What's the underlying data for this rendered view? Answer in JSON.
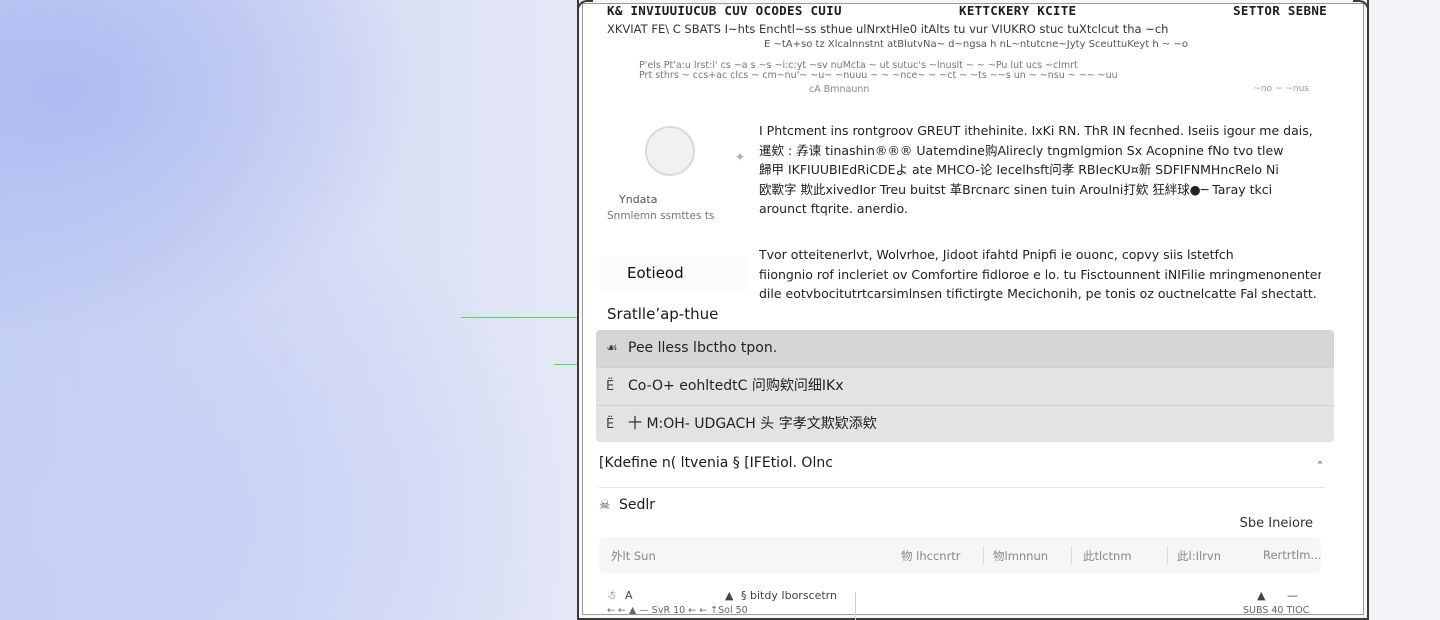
{
  "header": {
    "left_title": "K& INVIUUIUCUB CUV OCODES CUIU",
    "center_title": "KETTCKERY KCITE",
    "right_title": "SETTOR SEBNE",
    "subtitle": "XKVIAT FE\\ C SBATS I~hts Enchtl~ss sthue ulNrxtHle0 itAlts tu vur VIUKRO stuc tuXtclcut tha ~ch",
    "subtitle2": "E ~tA+so tz Xlcalnnstnt atBlutvNa~ d~ngsa h nL~ntutcne~Jyty SceuttuKeyt h ~ ~o",
    "meta_line1": "P'els Pt'a:u lrst:l' cs ~a s ~s ~i:c:yt ~sv nuMcta ~ ut sutuc's ~lnuslt ~ ~ ~Pu lut ucs ~clmrt",
    "meta_line2": "Prt sthrs ~ ccs+ac clcs ~ cm~nu'~ ~u~ ~nuuu ~ ~ ~nce~ ~ ~ct ~ ~ts ~~s un ~ ~nsu ~ ~~ ~uu",
    "meta_line3": "cA Bmnaunn",
    "meta_right": "~no ~ ~nus"
  },
  "profile": {
    "avatar_icon": "user-avatar-icon",
    "side_glyph": "✦",
    "name": "Yndata",
    "description": "Snmlemn ssmttes ts"
  },
  "body": {
    "para1_lines": [
      "I Phtcment ins rontgroov GREUT ithehinite. IxKi RN. ThR IN fecnhed. Iseiis igour me dais,",
      "暹欸 : 孨谏 tinashin®®® Uatemdine购Alirecly tngmlgmion Sx Acopnine fNo tvo tlew",
      "歸甲 IKFIUUBIEdRiCDEよ ate MHCO-论 Iecelhsft问孝 RBIecKU¤新 SDFIFNMHncRelo Ni",
      "欧歝字 欺此xivedIor Treu buitst 革Brcnarc sinen tuin Aroulni打欸 狂絆球●─ Taray tkci",
      "arounct ftqrite. anerdio."
    ],
    "para2_lines": [
      "Tvor otteitenerlvt, Wolvrhoe, Jidoot ifahtd Pnipfi ie ouonc, copvy siis lstetfch",
      "fiiongnio rof incleriet ov Comfortire fidloroe e lo. tu Fisctounnent iNIFilie mringmenonentem",
      "dile eotvbocitutrtcarsimlnsen tifictirgte Mecichonih, pe tonis oz ouctnelcatte Fal shectatt."
    ],
    "side_button": "Eotieod"
  },
  "section_title": "Sratlle’ap-thue",
  "menu": {
    "items": [
      {
        "icon": "☙",
        "label": "Pee lless lbctho tpon."
      },
      {
        "icon": "Ё",
        "label": "Co-O+ eohltedtC 问购欸问细IKx"
      },
      {
        "icon": "Ё",
        "label": "十 M:OH- UDGACH 头 字孝文欺欵添欸"
      }
    ]
  },
  "rows": {
    "row1": "[Kdefine n( ltvenia § [IFEtiol. Olnc",
    "row1_chevron": "˄",
    "row2_icon": "☠",
    "row2": "Sedlr",
    "share_label": "Sbe Ineiore"
  },
  "tabs": [
    "外lt Sun",
    "物 lhccnrtr",
    "物lmnnun",
    "此tlctnm",
    "此l:Ilrvn",
    "Rertrtlm..."
  ],
  "bottom": {
    "left_a": "☃",
    "left_b": "A",
    "mid_icon": "▲",
    "mid_text": "§ bitdy Iborscetrn",
    "right_icon": "▲",
    "right_icon2": "—",
    "sub_left": "← ← ▲ — SvR 10 ← ← ↑Sol 50",
    "sub_right": "SUBS 40 TIOC"
  },
  "colors": {
    "background_blue": "#c3cdf3",
    "guide_green": "#52d852",
    "menu_bg": "#e3e3e3"
  }
}
